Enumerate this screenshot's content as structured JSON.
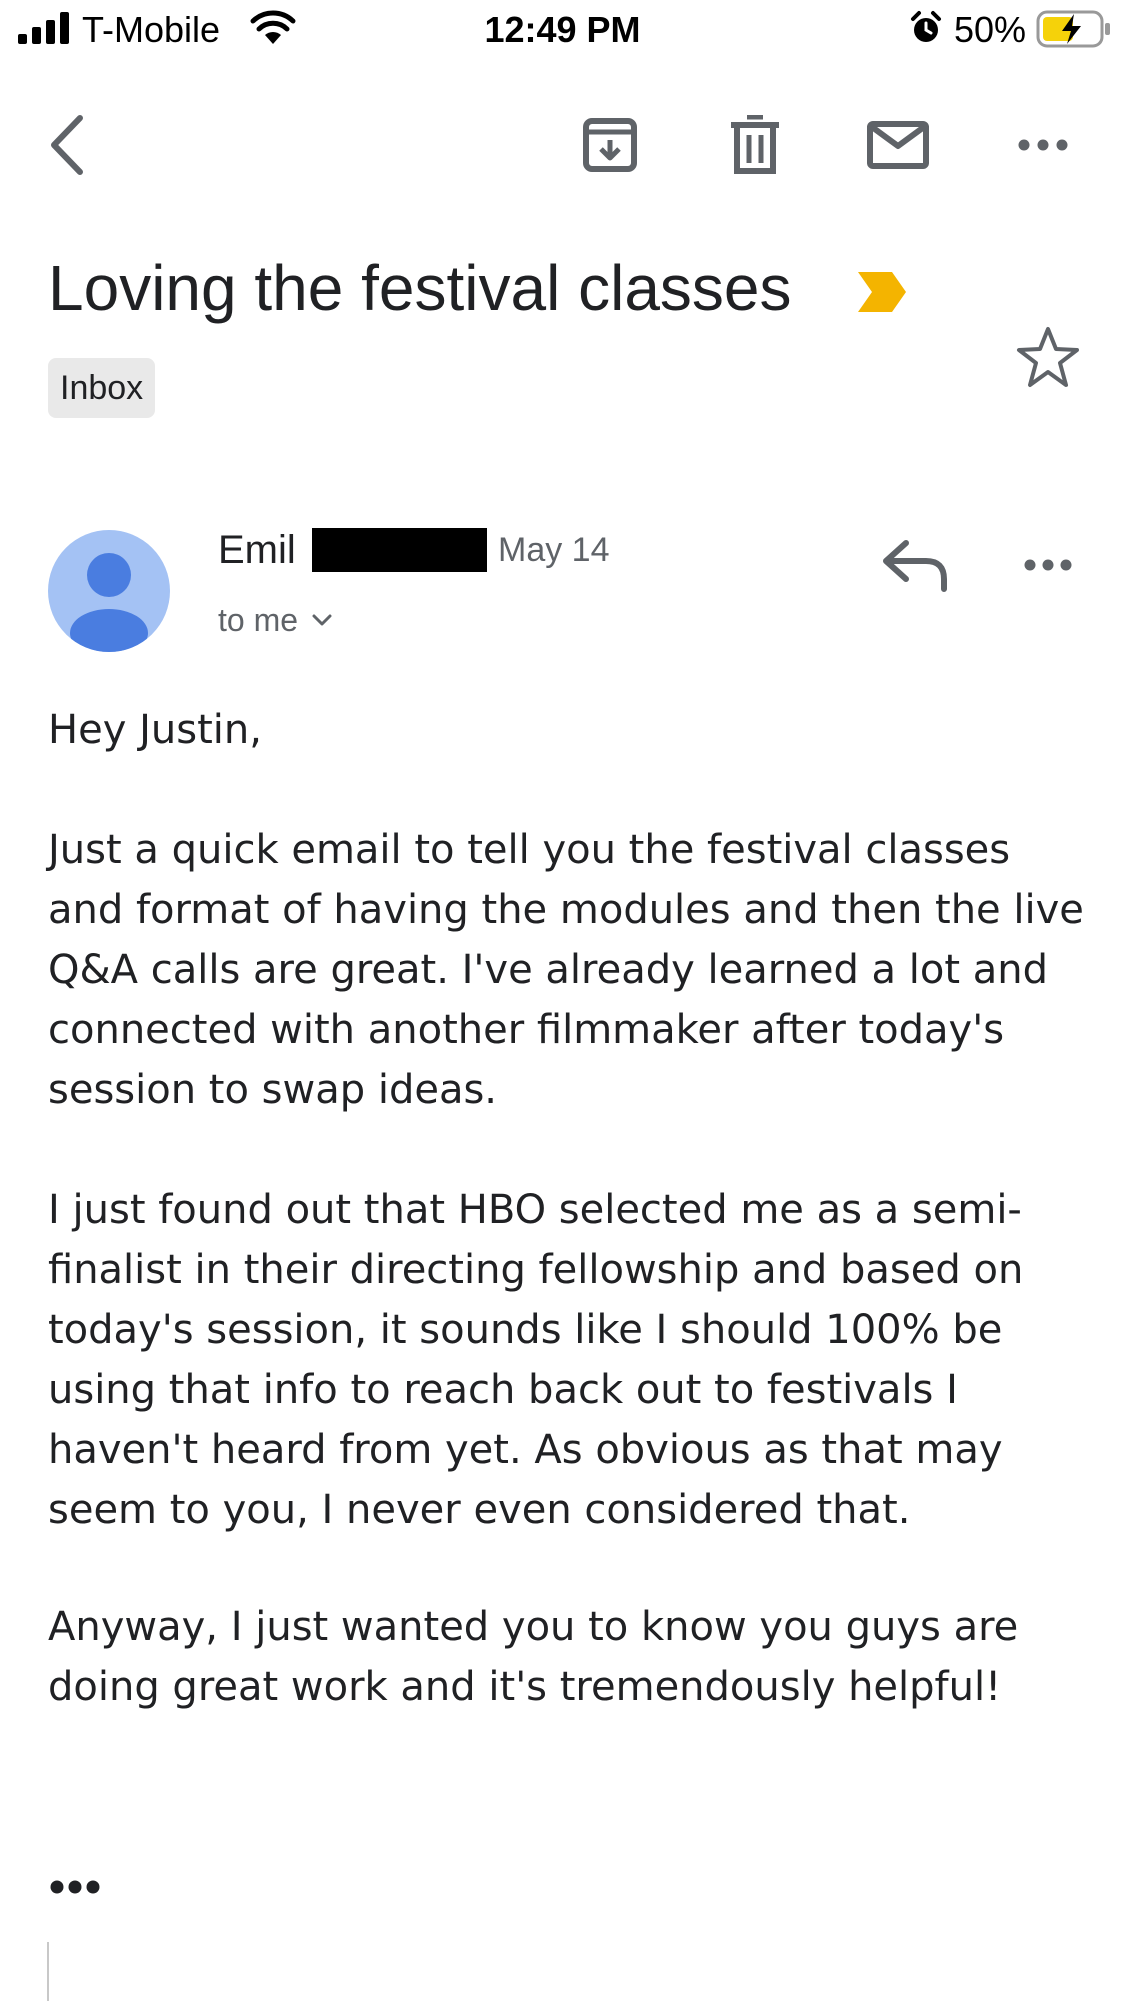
{
  "status_bar": {
    "carrier": "T-Mobile",
    "time": "12:49 PM",
    "battery_percent": "50%"
  },
  "toolbar": {
    "back_icon": "chevron-left-icon",
    "archive_icon": "archive-icon",
    "delete_icon": "trash-icon",
    "mark_unread_icon": "mail-icon",
    "more_icon": "more-horizontal-icon"
  },
  "email": {
    "subject": "Loving the festival classes",
    "label": "Inbox",
    "sender_name": "Emil",
    "date": "May 14",
    "recipients": "to me",
    "greeting": "Hey Justin,",
    "paragraphs": [
      "Just a quick email to tell you the festival classes and format of having the modules and then the live Q&A calls are great. I've already learned a lot and connected with another filmmaker after today's session to swap ideas.",
      "I just found out that HBO selected me as a semi-finalist in their directing fellowship and based on today's session, it sounds like I should 100% be using that info to reach back out to festivals I haven't heard from yet. As obvious as that may seem to you, I never even considered that.",
      "Anyway, I just wanted you to know you guys are doing great work and it's tremendously helpful!"
    ]
  },
  "colors": {
    "importance": "#f4b400",
    "avatar_bg": "#a4c2f4",
    "avatar_fg": "#4a7de0",
    "battery_fill": "#f5d20a",
    "icon_gray": "#5f6368"
  }
}
